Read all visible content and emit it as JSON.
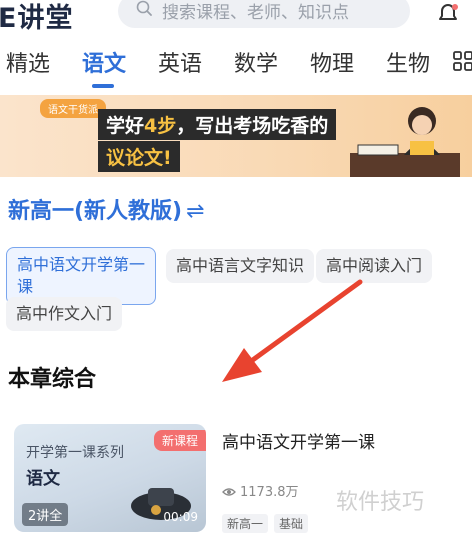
{
  "header": {
    "logo": "E讲堂",
    "search_placeholder": "搜索课程、老师、知识点"
  },
  "tabs": [
    {
      "label": "精选"
    },
    {
      "label": "语文"
    },
    {
      "label": "英语"
    },
    {
      "label": "数学"
    },
    {
      "label": "物理"
    },
    {
      "label": "生物"
    }
  ],
  "active_tab": "语文",
  "banner": {
    "ribbon": "语文干货派",
    "line1_pre": "学好",
    "line1_hl": "4步",
    "line1_post": "，写出考场吃香的",
    "line2": "议论文!"
  },
  "grade": {
    "label": "新高一(新人教版)",
    "swap_symbol": "⇌"
  },
  "chips": [
    {
      "label": "高中语文开学第一课"
    },
    {
      "label": "高中语言文字知识"
    },
    {
      "label": "高中阅读入门"
    },
    {
      "label": "高中作文入门"
    }
  ],
  "section": {
    "title": "本章综合"
  },
  "course": {
    "thumb_series": "开学第一课系列",
    "thumb_subject": "语文",
    "badge": "新课程",
    "lessons": "2讲全",
    "duration": "00:09",
    "title": "高中语文开学第一课",
    "views": "1173.8万",
    "tags": [
      "新高一",
      "基础"
    ]
  },
  "watermark": "软件技巧",
  "colors": {
    "accent": "#2f6fd8",
    "arrow": "#e8432f",
    "badge": "#f36f6f"
  }
}
